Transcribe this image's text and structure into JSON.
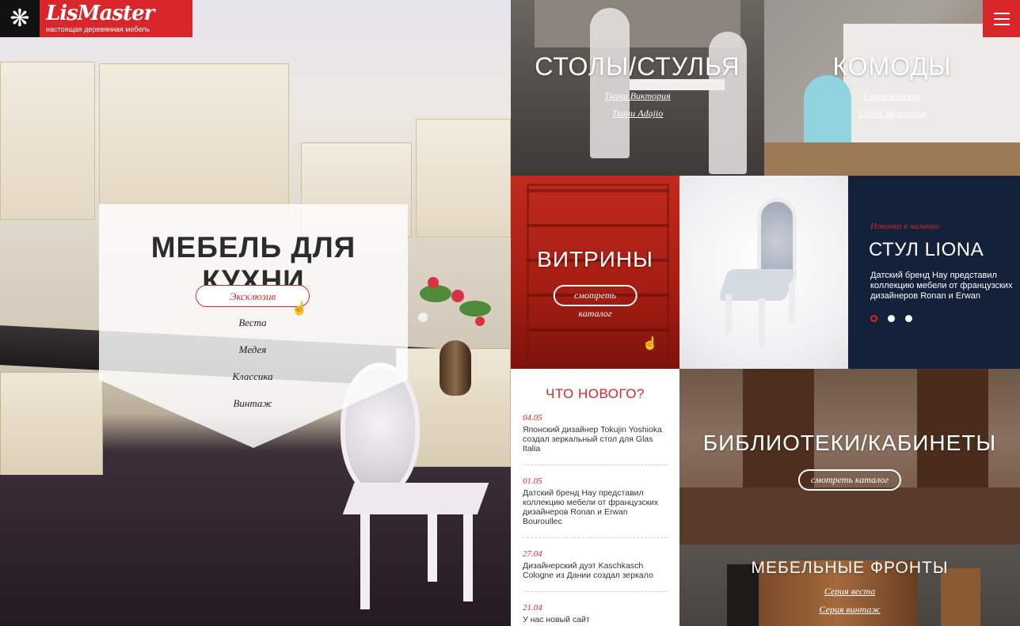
{
  "logo": {
    "name": "LisMaster",
    "tagline": "настоящая деревянная мебель",
    "mark": "❋"
  },
  "hero": {
    "title": "МЕБЕЛЬ ДЛЯ КУХНИ",
    "menu": [
      {
        "label": "Эксклюзив",
        "active": true
      },
      {
        "label": "Веста",
        "active": false
      },
      {
        "label": "Медея",
        "active": false
      },
      {
        "label": "Классика",
        "active": false
      },
      {
        "label": "Винтаж",
        "active": false
      }
    ]
  },
  "tiles": {
    "tables": {
      "title": "СТОЛЫ/СТУЛЬЯ",
      "links": [
        "Ткани Виктория",
        "Ткани Adajio"
      ]
    },
    "commodes": {
      "title": "КОМОДЫ",
      "links": [
        "Серия классик",
        "Серия эксклюзив"
      ]
    },
    "vitrines": {
      "title": "ВИТРИНЫ",
      "button": "смотреть каталог"
    },
    "library": {
      "title": "БИБЛИОТЕКИ/КАБИНЕТЫ",
      "button": "смотреть каталог"
    },
    "fronts": {
      "title": "МЕБЕЛЬНЫЕ ФРОНТЫ",
      "links": [
        "Серия веста",
        "Серия винтаж"
      ]
    }
  },
  "promo": {
    "tag": "Новинка в наличии",
    "title": "СТУЛ LIONA",
    "text": "Датский бренд Hay представил коллекцию мебели от французских дизайнеров Ronan и Erwan",
    "dots": 3,
    "active_dot": 0
  },
  "whats_new": {
    "title": "ЧТО НОВОГО?",
    "items": [
      {
        "date": "04.05",
        "text": "Японский дизайнер Tokujin Yoshioka создал зеркальный стол для Glas Italia"
      },
      {
        "date": "01.05",
        "text": "Датский бренд Hay представил коллекцию мебели от французских дизайнеров Ronan и Erwan Bouroullec"
      },
      {
        "date": "27.04",
        "text": "Дизайнерский дуэт Kaschkasch Cologne из Дании создал зеркало"
      },
      {
        "date": "21.04",
        "text": "У нас новый сайт"
      }
    ]
  },
  "colors": {
    "accent": "#d8262a",
    "navy": "#14213b",
    "vitrine_red": "#b8241a"
  }
}
